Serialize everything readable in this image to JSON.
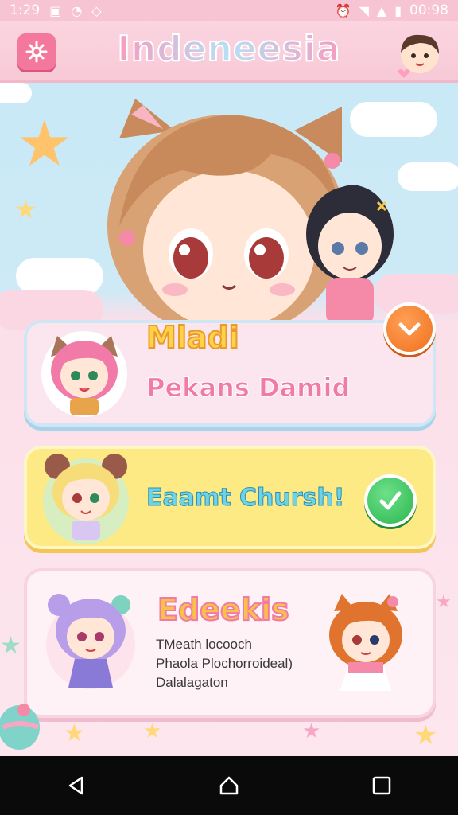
{
  "status_bar": {
    "time": "1:29",
    "clock": "00:98",
    "icons": [
      "notification-icon",
      "o-icon",
      "shield-icon",
      "alarm-icon",
      "wifi-icon",
      "signal-icon",
      "battery-icon"
    ]
  },
  "header": {
    "title": "Indeneesia",
    "menu_icon": "sparkle-menu-icon",
    "avatar_icon": "profile-avatar"
  },
  "cards": [
    {
      "name": "Mladi",
      "subtitle": "Pekans Damid",
      "badge_icon": "chevron-down-icon"
    },
    {
      "name": "Eaamt Chursh!",
      "badge_icon": "check-icon"
    },
    {
      "name": "Edeekis",
      "description": [
        "TMeath locooch",
        "Phaola Plochorroideal)",
        "Dalalagaton"
      ]
    }
  ],
  "nav": {
    "back": "back-triangle-icon",
    "home": "home-icon",
    "recents": "recents-square-icon"
  },
  "colors": {
    "header_bg": "#f8c9d7",
    "orange_badge": "#f0701c",
    "green_badge": "#2bb64e",
    "card_yellow": "#fdea84"
  }
}
